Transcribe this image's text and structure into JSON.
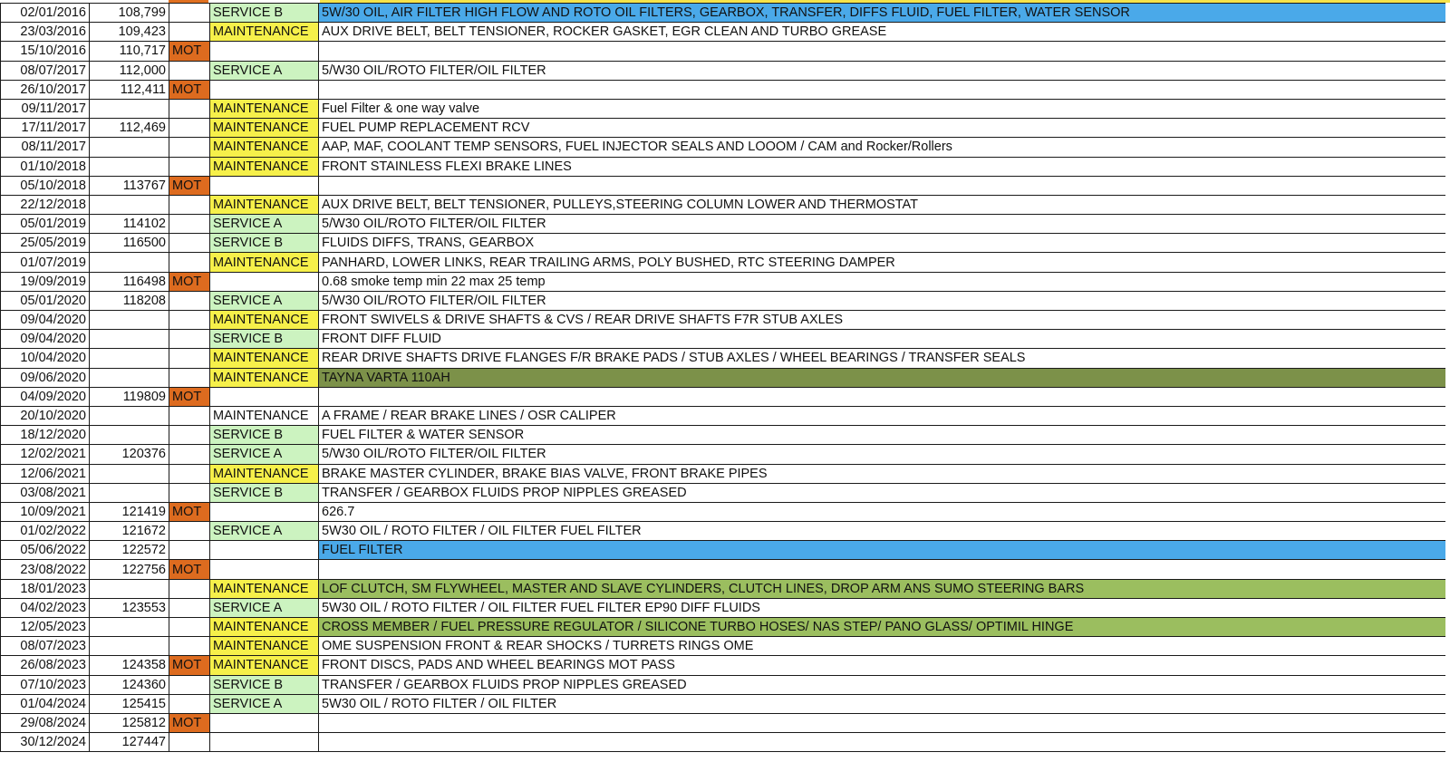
{
  "colors": {
    "mot": "#dd6b1f",
    "service": "#ccf3c0",
    "maintenance": "#f6f04a",
    "blue_highlight": "#4aa9e9",
    "olive_highlight": "#7c9149",
    "green_highlight": "#9bbe5f"
  },
  "rows": [
    {
      "date": "02/01/2016",
      "miles": "108,799",
      "mot": "",
      "type": "SERVICE B",
      "desc": "5W/30 OIL, AIR FILTER  HIGH FLOW AND ROTO OIL FILTERS,  GEARBOX, TRANSFER, DIFFS FLUID, FUEL FILTER, WATER SENSOR",
      "type_style": "svc",
      "desc_style": "blue"
    },
    {
      "date": "23/03/2016",
      "miles": "109,423",
      "mot": "",
      "type": "MAINTENANCE",
      "desc": "AUX DRIVE BELT, BELT TENSIONER, ROCKER GASKET, EGR CLEAN AND TURBO GREASE",
      "type_style": "maint",
      "desc_style": ""
    },
    {
      "date": "15/10/2016",
      "miles": "110,717",
      "mot": "MOT",
      "type": "",
      "desc": "",
      "type_style": "",
      "desc_style": ""
    },
    {
      "date": "08/07/2017",
      "miles": "112,000",
      "mot": "",
      "type": "SERVICE A",
      "desc": "5/W30 OIL/ROTO FILTER/OIL FILTER",
      "type_style": "svc",
      "desc_style": ""
    },
    {
      "date": "26/10/2017",
      "miles": "112,411",
      "mot": "MOT",
      "type": "",
      "desc": "",
      "type_style": "",
      "desc_style": ""
    },
    {
      "date": "09/11/2017",
      "miles": "",
      "mot": "",
      "type": "MAINTENANCE",
      "desc": "Fuel Filter & one way valve",
      "type_style": "maint",
      "desc_style": ""
    },
    {
      "date": "17/11/2017",
      "miles": "112,469",
      "mot": "",
      "type": "MAINTENANCE",
      "desc": "FUEL PUMP REPLACEMENT RCV",
      "type_style": "maint",
      "desc_style": ""
    },
    {
      "date": "08/11/2017",
      "miles": "",
      "mot": "",
      "type": "MAINTENANCE",
      "desc": "AAP,  MAF, COOLANT TEMP SENSORS, FUEL INJECTOR SEALS AND LOOOM  / CAM and Rocker/Rollers",
      "type_style": "maint",
      "desc_style": ""
    },
    {
      "date": "01/10/2018",
      "miles": "",
      "mot": "",
      "type": "MAINTENANCE",
      "desc": "FRONT STAINLESS FLEXI BRAKE LINES",
      "type_style": "maint",
      "desc_style": ""
    },
    {
      "date": "05/10/2018",
      "miles": "113767",
      "mot": "MOT",
      "type": "",
      "desc": "",
      "type_style": "",
      "desc_style": ""
    },
    {
      "date": "22/12/2018",
      "miles": "",
      "mot": "",
      "type": "MAINTENANCE",
      "desc": "AUX DRIVE BELT, BELT TENSIONER, PULLEYS,STEERING COLUMN LOWER AND THERMOSTAT",
      "type_style": "maint",
      "desc_style": ""
    },
    {
      "date": "05/01/2019",
      "miles": "114102",
      "mot": "",
      "type": "SERVICE A",
      "desc": "5/W30 OIL/ROTO FILTER/OIL FILTER",
      "type_style": "svc",
      "desc_style": ""
    },
    {
      "date": "25/05/2019",
      "miles": "116500",
      "mot": "",
      "type": "SERVICE B",
      "desc": "FLUIDS DIFFS, TRANS, GEARBOX",
      "type_style": "svc",
      "desc_style": ""
    },
    {
      "date": "01/07/2019",
      "miles": "",
      "mot": "",
      "type": "MAINTENANCE",
      "desc": "PANHARD, LOWER LINKS, REAR TRAILING ARMS,  POLY BUSHED, RTC STEERING DAMPER",
      "type_style": "maint",
      "desc_style": ""
    },
    {
      "date": "19/09/2019",
      "miles": "116498",
      "mot": "MOT",
      "type": "",
      "desc": "0.68  smoke temp min 22 max 25 temp",
      "type_style": "",
      "desc_style": ""
    },
    {
      "date": "05/01/2020",
      "miles": "118208",
      "mot": "",
      "type": "SERVICE A",
      "desc": "5/W30 OIL/ROTO FILTER/OIL FILTER",
      "type_style": "svc",
      "desc_style": ""
    },
    {
      "date": "09/04/2020",
      "miles": "",
      "mot": "",
      "type": "MAINTENANCE",
      "desc": "FRONT SWIVELS & DRIVE SHAFTS & CVS / REAR DRIVE SHAFTS F7R STUB AXLES",
      "type_style": "maint",
      "desc_style": ""
    },
    {
      "date": "09/04/2020",
      "miles": "",
      "mot": "",
      "type": "SERVICE B",
      "desc": "FRONT DIFF FLUID",
      "type_style": "svc",
      "desc_style": ""
    },
    {
      "date": "10/04/2020",
      "miles": "",
      "mot": "",
      "type": "MAINTENANCE",
      "desc": "REAR DRIVE SHAFTS DRIVE FLANGES F/R BRAKE PADS / STUB AXLES / WHEEL BEARINGS / TRANSFER SEALS",
      "type_style": "maint",
      "desc_style": ""
    },
    {
      "date": "09/06/2020",
      "miles": "",
      "mot": "",
      "type": "MAINTENANCE",
      "desc": "TAYNA VARTA 110AH",
      "type_style": "maint",
      "desc_style": "olive"
    },
    {
      "date": "04/09/2020",
      "miles": "119809",
      "mot": "MOT",
      "type": "",
      "desc": "",
      "type_style": "",
      "desc_style": ""
    },
    {
      "date": "20/10/2020",
      "miles": "",
      "mot": "",
      "type": "MAINTENANCE",
      "desc": "A FRAME / REAR BRAKE LINES / OSR CALIPER",
      "type_style": "",
      "desc_style": ""
    },
    {
      "date": "18/12/2020",
      "miles": "",
      "mot": "",
      "type": "SERVICE B",
      "desc": "FUEL FILTER & WATER SENSOR",
      "type_style": "svc",
      "desc_style": ""
    },
    {
      "date": "12/02/2021",
      "miles": "120376",
      "mot": "",
      "type": "SERVICE A",
      "desc": "5/W30 OIL/ROTO FILTER/OIL FILTER",
      "type_style": "svc",
      "desc_style": ""
    },
    {
      "date": "12/06/2021",
      "miles": "",
      "mot": "",
      "type": "MAINTENANCE",
      "desc": "BRAKE MASTER CYLINDER, BRAKE BIAS VALVE, FRONT BRAKE PIPES",
      "type_style": "maint",
      "desc_style": ""
    },
    {
      "date": "03/08/2021",
      "miles": "",
      "mot": "",
      "type": "SERVICE B",
      "desc": "TRANSFER / GEARBOX FLUIDS PROP  NIPPLES GREASED",
      "type_style": "svc",
      "desc_style": ""
    },
    {
      "date": "10/09/2021",
      "miles": "121419",
      "mot": "MOT",
      "type": "",
      "desc": "626.7",
      "type_style": "",
      "desc_style": ""
    },
    {
      "date": "01/02/2022",
      "miles": "121672",
      "mot": "",
      "type": "SERVICE A",
      "desc": "5W30 OIL / ROTO FILTER / OIL FILTER FUEL FILTER",
      "type_style": "svc",
      "desc_style": ""
    },
    {
      "date": "05/06/2022",
      "miles": "122572",
      "mot": "",
      "type": "",
      "desc": "FUEL FILTER",
      "type_style": "",
      "desc_style": "blue"
    },
    {
      "date": "23/08/2022",
      "miles": "122756",
      "mot": "MOT",
      "type": "",
      "desc": "",
      "type_style": "",
      "desc_style": ""
    },
    {
      "date": "18/01/2023",
      "miles": "",
      "mot": "",
      "type": "MAINTENANCE",
      "desc": "LOF CLUTCH, SM FLYWHEEL, MASTER AND SLAVE CYLINDERS, CLUTCH LINES, DROP ARM ANS SUMO STEERING BARS",
      "type_style": "maint",
      "desc_style": "green"
    },
    {
      "date": "04/02/2023",
      "miles": "123553",
      "mot": "",
      "type": "SERVICE A",
      "desc": "5W30 OIL / ROTO FILTER / OIL FILTER FUEL FILTER  EP90 DIFF FLUIDS",
      "type_style": "svc",
      "desc_style": ""
    },
    {
      "date": "12/05/2023",
      "miles": "",
      "mot": "",
      "type": "MAINTENANCE",
      "desc": "CROSS MEMBER / FUEL PRESSURE REGULATOR / SILICONE TURBO HOSES/ NAS STEP/ PANO GLASS/ OPTIMIL HINGE",
      "type_style": "maint",
      "desc_style": "green"
    },
    {
      "date": "08/07/2023",
      "miles": "",
      "mot": "",
      "type": "MAINTENANCE",
      "desc": "OME SUSPENSION FRONT & REAR SHOCKS / TURRETS RINGS OME",
      "type_style": "maint",
      "desc_style": ""
    },
    {
      "date": "26/08/2023",
      "miles": "124358",
      "mot": "MOT",
      "type": "MAINTENANCE",
      "desc": "FRONT DISCS, PADS AND WHEEL BEARINGS MOT PASS",
      "type_style": "maint",
      "desc_style": ""
    },
    {
      "date": "07/10/2023",
      "miles": "124360",
      "mot": "",
      "type": "SERVICE B",
      "desc": "TRANSFER / GEARBOX FLUIDS PROP  NIPPLES GREASED",
      "type_style": "svc",
      "desc_style": ""
    },
    {
      "date": "01/04/2024",
      "miles": "125415",
      "mot": "",
      "type": "SERVICE A",
      "desc": "5W30 OIL / ROTO FILTER / OIL FILTER",
      "type_style": "svc",
      "desc_style": ""
    },
    {
      "date": "29/08/2024",
      "miles": "125812",
      "mot": "MOT",
      "type": "",
      "desc": "",
      "type_style": "",
      "desc_style": ""
    },
    {
      "date": "30/12/2024",
      "miles": "127447",
      "mot": "",
      "type": "",
      "desc": "",
      "type_style": "",
      "desc_style": ""
    }
  ]
}
